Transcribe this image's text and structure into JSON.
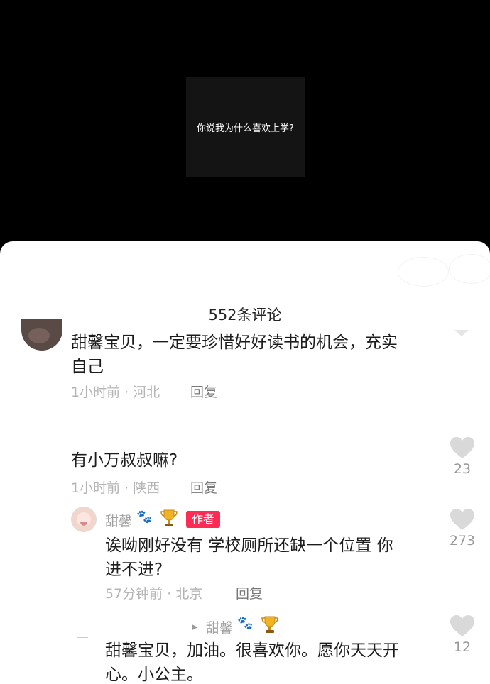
{
  "video": {
    "caption": "你说我为什么喜欢上学?"
  },
  "comments_panel": {
    "count_label": "552条评论",
    "comments": [
      {
        "text": "甜馨宝贝，一定要珍惜好好读书的机会，充实自己",
        "line1": "甜馨宝贝，一定要珍惜好好读书的机会，充实",
        "line2": "自己",
        "meta": "1小时前 · 河北",
        "reply_label": "回复"
      },
      {
        "text": "有小万叔叔嘛?",
        "meta": "1小时前 · 陕西",
        "reply_label": "回复",
        "likes": "23"
      }
    ],
    "author_reply": {
      "username": "甜馨",
      "paw": "🐾",
      "badge": "作者",
      "line1": "诶呦刚好没有 学校厕所还缺一个位置 你",
      "line2": "进不进?",
      "meta": "57分钟前 · 北京",
      "reply_label": "回复",
      "likes": "273"
    },
    "nested_reply": {
      "reply_to": "甜馨",
      "paw": "🐾",
      "line1": "甜馨宝贝，加油。很喜欢你。愿你天天开",
      "line2": "心。小公主。",
      "likes": "12"
    }
  }
}
